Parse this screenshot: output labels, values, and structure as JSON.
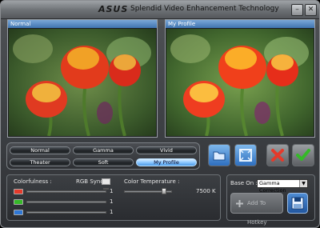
{
  "titlebar": {
    "brand": "ASUS",
    "title": "Splendid Video Enhancement Technology",
    "minimize_label": "–",
    "close_label": "✕"
  },
  "panels": {
    "left_label": "Normal",
    "right_label": "My Profile"
  },
  "modes": [
    {
      "label": "Normal"
    },
    {
      "label": "Gamma"
    },
    {
      "label": "Vivid"
    },
    {
      "label": "Theater"
    },
    {
      "label": "Soft"
    },
    {
      "label": "My Profile",
      "selected": true
    }
  ],
  "controls": {
    "colorfulness_label": "Colorfulness :",
    "rgb_sync_label": "RGB Sync.",
    "color_temp_label": "Color Temperature :",
    "color_temp_value": "7500 K",
    "r_value": "1",
    "g_value": "1",
    "b_value": "1"
  },
  "base_on": {
    "label": "Base On :",
    "selected": "Gamma Correction"
  },
  "actions": {
    "add_hotkey": "Add To Hotkey"
  },
  "colors": {
    "accent": "#4c9ae6",
    "red": "#e53a2b",
    "green": "#35b928",
    "blue": "#2e77d6"
  }
}
